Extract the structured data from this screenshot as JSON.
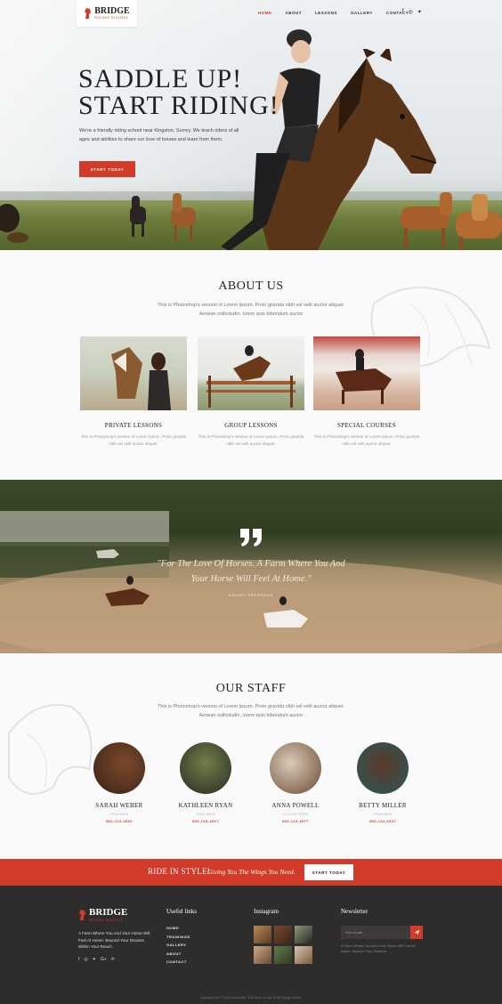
{
  "brand": {
    "name": "BRIDGE",
    "tagline": "RIDING SCHOOL",
    "accent": "#d23a2a",
    "dark": "#2f2c2c"
  },
  "nav": {
    "items": [
      "HOME",
      "ABOUT",
      "LESSONS",
      "GALLERY",
      "CONTACT"
    ],
    "active": "HOME"
  },
  "social_icons": [
    "facebook-icon",
    "instagram-icon",
    "twitter-icon"
  ],
  "hero": {
    "title_line1": "SADDLE UP!",
    "title_line2": "START RIDING!",
    "subtitle": "We're a friendly riding school near Kingston, Surrey. We teach riders of all ages and abilities to share our love of horses and learn from them.",
    "button": "START TODAY"
  },
  "about": {
    "title": "ABOUT US",
    "desc_line1": "This is Photoshop's version  of Lorem Ipsum. Proin gravida nibh vel velit auctor aliquet.",
    "desc_line2": "Aenean sollicitudin, lorem quis bibendum auctor",
    "cards": [
      {
        "title": "PRIVATE LESSONS",
        "text": "This is Photoshop's version  of Lorem Ipsum. Proin gravida nibh vel velit auctor aliquet."
      },
      {
        "title": "GROUP LESSONS",
        "text": "This is Photoshop's version  of Lorem Ipsum. Proin gravida nibh vel velit auctor aliquet."
      },
      {
        "title": "SPECIAL COURSES",
        "text": "This is Photoshop's version  of Lorem Ipsum. Proin gravida nibh vel velit auctor aliquet."
      }
    ]
  },
  "quote": {
    "line1": "\"For The Love Of Horses. A Farm Where You And",
    "line2": "Your Horse Will Feel At Home.\"",
    "author": "DAVIDE PETERSON"
  },
  "staff": {
    "title": "OUR STAFF",
    "desc_line1": "This is Photoshop's version  of Lorem Ipsum. Proin gravida nibh vel velit auctor aliquet.",
    "desc_line2": "Aenean sollicitudin, lorem quis bibendum auctor",
    "members": [
      {
        "name": "SARAH WEBER",
        "role": "TRAINER",
        "phone": "800-122-4860"
      },
      {
        "name": "KATHLEEN RYAN",
        "role": "TRAINER",
        "phone": "800-135-4067"
      },
      {
        "name": "ANNA POWELL",
        "role": "VOLUNTEER",
        "phone": "800-123-4577"
      },
      {
        "name": "BETTY MILLER",
        "role": "TRAINER",
        "phone": "800-142-4347"
      }
    ]
  },
  "cta": {
    "strong": "RIDE IN STYLE!",
    "italic": "Giving You The Wings You Need.",
    "button": "START TODAY"
  },
  "footer": {
    "about": "A Farm Where You And Your Horse Will Feel At Home. Beyond Your Dreams. Within Your Reach.",
    "social_icons": [
      "facebook-icon",
      "instagram-icon",
      "twitter-icon",
      "google-plus-icon",
      "pinterest-icon"
    ],
    "useful_links_title": "Useful links",
    "links": [
      "HOME",
      "TRAININGS",
      "GALLERY",
      "ABOUT",
      "CONTACT"
    ],
    "instagram_title": "Instagram",
    "newsletter_title": "Newsletter",
    "newsletter_placeholder": "Your email...",
    "newsletter_text": "A Farm Where You And Your Horse Will Feel At Home. Beyond Your Dreams.",
    "copyright": "Copyright 2017 Qode Interactive. This demo is part of the Bridge theme."
  }
}
